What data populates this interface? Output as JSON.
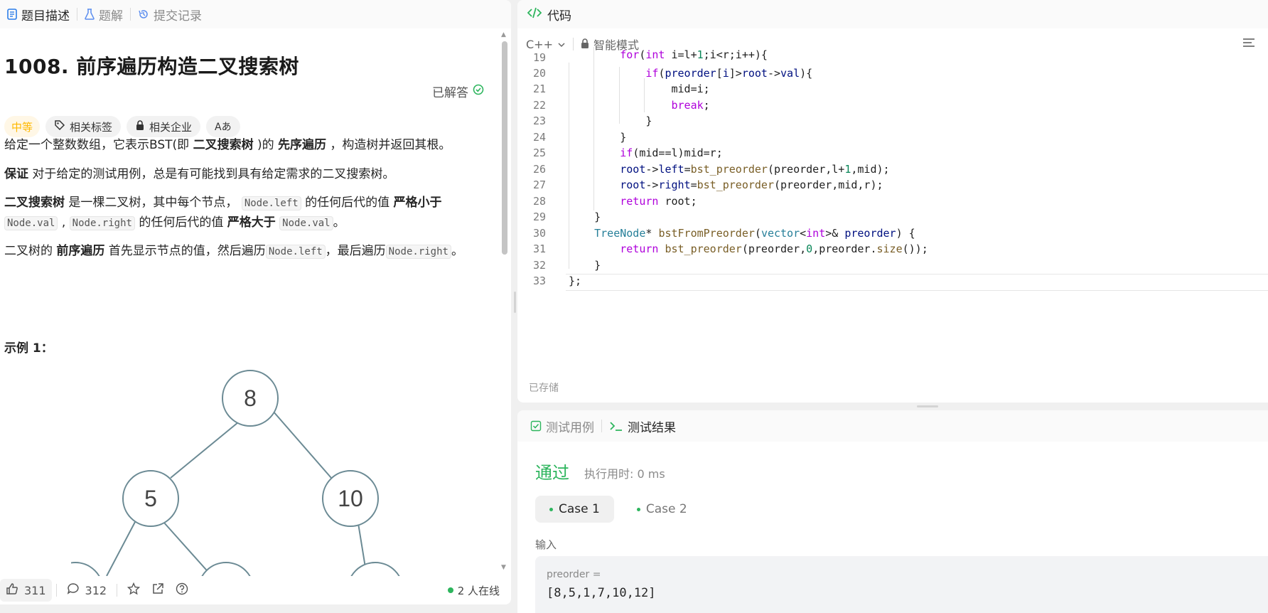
{
  "left_tabs": [
    {
      "label": "题目描述",
      "icon": "description-icon",
      "active": true
    },
    {
      "label": "题解",
      "icon": "flask-icon",
      "active": false
    },
    {
      "label": "提交记录",
      "icon": "history-icon",
      "active": false
    }
  ],
  "problem": {
    "title": "1008. 前序遍历构造二叉搜索树",
    "solved_label": "已解答",
    "difficulty": "中等",
    "tag_topics": "相关标签",
    "tag_companies": "相关企业",
    "tag_translate": "Aあ"
  },
  "description": {
    "p1_a": "给定一个整数数组，它表示BST(即 ",
    "p1_b": "二叉搜索树",
    "p1_c": " )的 ",
    "p1_d": "先序遍历",
    "p1_e": " ，构造树并返回其根。",
    "p2_a": "保证",
    "p2_b": " 对于给定的测试用例，总是有可能找到具有给定需求的二叉搜索树。",
    "p3_a": "二叉搜索树",
    "p3_b": " 是一棵二叉树，其中每个节点，",
    "p3_c": "Node.left",
    "p3_d": " 的任何后代的值 ",
    "p3_e": "严格小于",
    "p3_f": "Node.val",
    "p3_g": " , ",
    "p3_h": "Node.right",
    "p3_i": " 的任何后代的值 ",
    "p3_j": "严格大于",
    "p3_k": "Node.val",
    "p3_l": "。",
    "p4_a": "二叉树的 ",
    "p4_b": "前序遍历",
    "p4_c": " 首先显示节点的值，然后遍历",
    "p4_d": "Node.left",
    "p4_e": "，最后遍历",
    "p4_f": "Node.right",
    "p4_g": "。",
    "example_title": "示例 1："
  },
  "tree_nodes": [
    "8",
    "5",
    "10"
  ],
  "footer": {
    "likes": "311",
    "comments": "312",
    "online": "2 人在线"
  },
  "editor": {
    "title": "代码",
    "language": "C++",
    "mode": "智能模式",
    "saved": "已存储",
    "line_numbers": [
      "19",
      "20",
      "21",
      "22",
      "23",
      "24",
      "25",
      "26",
      "27",
      "28",
      "29",
      "30",
      "31",
      "32",
      "33"
    ]
  },
  "console": {
    "tab_testcase": "测试用例",
    "tab_result": "测试结果",
    "status": "通过",
    "runtime": "执行用时: 0 ms",
    "cases": [
      "Case 1",
      "Case 2"
    ],
    "input_label": "输入",
    "var_name": "preorder =",
    "var_value": "[8,5,1,7,10,12]"
  },
  "colors": {
    "accent_green": "#2db55d",
    "difficulty_orange": "#ffb800"
  }
}
